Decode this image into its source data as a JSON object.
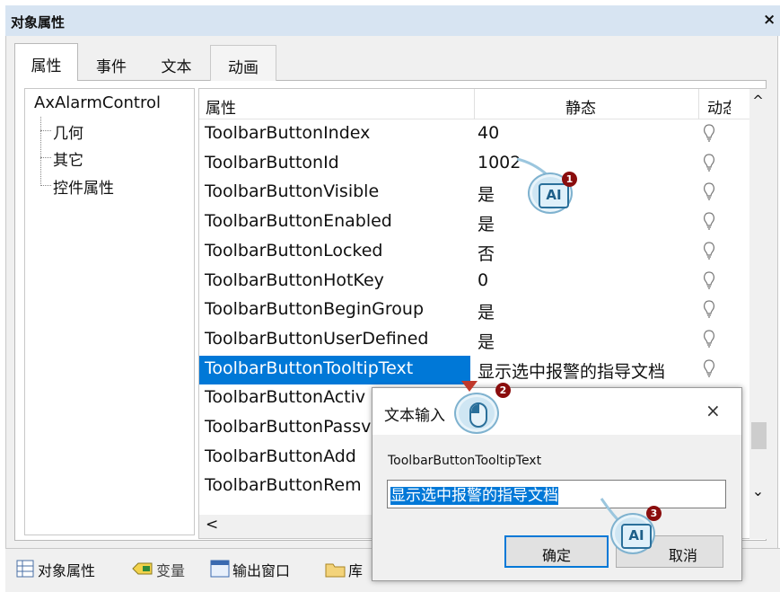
{
  "window": {
    "title": "对象属性",
    "close_glyph": "×"
  },
  "tabs": [
    "属性",
    "事件",
    "文本",
    "动画"
  ],
  "tree": {
    "root": "AxAlarmControl",
    "children": [
      "几何",
      "其它",
      "控件属性"
    ]
  },
  "grid": {
    "columns": [
      "属性",
      "静态",
      "动态"
    ],
    "rows": [
      {
        "prop": "ToolbarButtonIndex",
        "static": "40"
      },
      {
        "prop": "ToolbarButtonId",
        "static": "1002"
      },
      {
        "prop": "ToolbarButtonVisible",
        "static": "是"
      },
      {
        "prop": "ToolbarButtonEnabled",
        "static": "是"
      },
      {
        "prop": "ToolbarButtonLocked",
        "static": "否"
      },
      {
        "prop": "ToolbarButtonHotKey",
        "static": "0"
      },
      {
        "prop": "ToolbarButtonBeginGroup",
        "static": "是"
      },
      {
        "prop": "ToolbarButtonUserDefined",
        "static": "是"
      },
      {
        "prop": "ToolbarButtonTooltipText",
        "static": "显示选中报警的指导文档",
        "selected": true
      },
      {
        "prop": "ToolbarButtonActiv",
        "static": ""
      },
      {
        "prop": "ToolbarButtonPassv",
        "static": ""
      },
      {
        "prop": "ToolbarButtonAdd",
        "static": ""
      },
      {
        "prop": "ToolbarButtonRem",
        "static": ""
      }
    ],
    "scroll_up": "^",
    "scroll_down": "⌄",
    "scroll_left": "<"
  },
  "bottom_tabs": [
    "对象属性",
    "变量",
    "输出窗口",
    "库"
  ],
  "dialog": {
    "title": "文本输入",
    "close_glyph": "×",
    "field_label": "ToolbarButtonTooltipText",
    "field_value": "显示选中报警的指导文档",
    "ok_label": "确定",
    "cancel_label": "取消"
  },
  "callouts": [
    {
      "number": "1",
      "icon": "AI"
    },
    {
      "number": "2",
      "icon": "mouse-icon"
    },
    {
      "number": "3",
      "icon": "AI"
    }
  ],
  "colors": {
    "selection": "#0078d7",
    "titlebar": "#d7e4f2",
    "callout_number": "#8a0d0d"
  }
}
